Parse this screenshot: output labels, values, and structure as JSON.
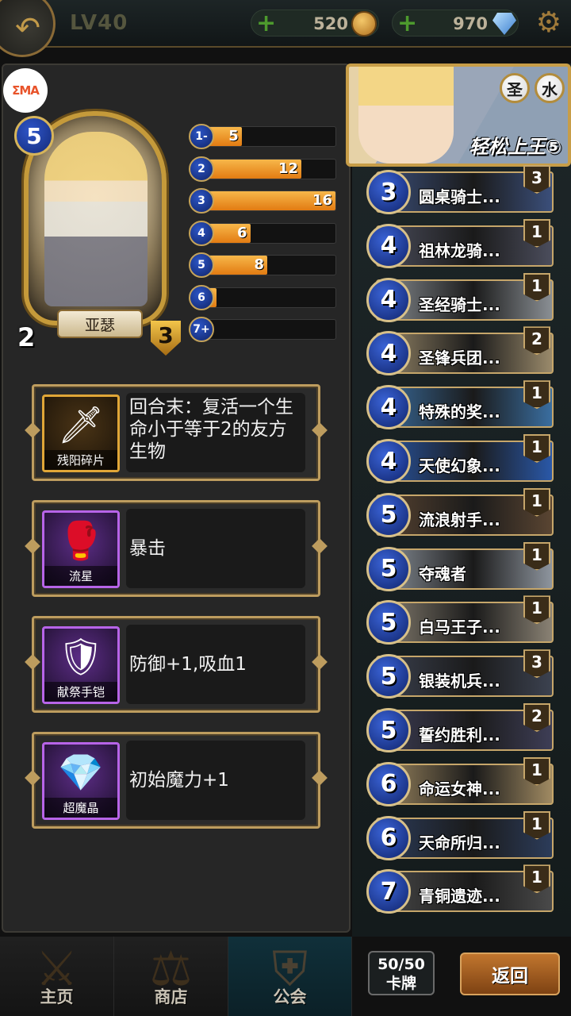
{
  "header": {
    "level": "LV40",
    "gold": "520",
    "gems": "970"
  },
  "hero": {
    "watermark": "ΣMA",
    "name": "亚瑟",
    "cost": "5",
    "attack": "2",
    "health": "3",
    "class_tags": [
      "圣",
      "水"
    ],
    "deck_title": "轻松上王⑤"
  },
  "mana_curve": [
    {
      "label": "1-",
      "count": "5",
      "value": 5
    },
    {
      "label": "2",
      "count": "12",
      "value": 12
    },
    {
      "label": "3",
      "count": "16",
      "value": 16
    },
    {
      "label": "4",
      "count": "6",
      "value": 6
    },
    {
      "label": "5",
      "count": "8",
      "value": 8
    },
    {
      "label": "6",
      "count": "2",
      "value": 2
    },
    {
      "label": "7+",
      "count": "1",
      "value": 1
    }
  ],
  "equipment": [
    {
      "name": "残阳碎片",
      "desc": "回合末：复活一个生命小于等于2的友方生物",
      "rarity": "gold",
      "icon": "dagger-icon"
    },
    {
      "name": "流星",
      "desc": "暴击",
      "rarity": "purple",
      "icon": "gauntlet-icon"
    },
    {
      "name": "献祭手铠",
      "desc": "防御+1,吸血1",
      "rarity": "purple",
      "icon": "armor-glove-icon"
    },
    {
      "name": "超魔晶",
      "desc": "初始魔力+1",
      "rarity": "purple",
      "icon": "crystal-icon"
    }
  ],
  "deck": [
    {
      "cost": "3",
      "name": "圆桌骑士...",
      "count": "3",
      "tint": "#3b4f7a"
    },
    {
      "cost": "4",
      "name": "祖林龙骑...",
      "count": "1",
      "tint": "#4b4d5c"
    },
    {
      "cost": "4",
      "name": "圣经骑士...",
      "count": "1",
      "tint": "#8a8f94"
    },
    {
      "cost": "4",
      "name": "圣锋兵团...",
      "count": "2",
      "tint": "#9a8a6b"
    },
    {
      "cost": "4",
      "name": "特殊的奖...",
      "count": "1",
      "tint": "#3a6ea0"
    },
    {
      "cost": "4",
      "name": "天使幻象...",
      "count": "1",
      "tint": "#2a58a8"
    },
    {
      "cost": "5",
      "name": "流浪射手...",
      "count": "1",
      "tint": "#5a4532"
    },
    {
      "cost": "5",
      "name": "夺魂者",
      "count": "1",
      "tint": "#8e959e"
    },
    {
      "cost": "5",
      "name": "白马王子...",
      "count": "1",
      "tint": "#8a8274"
    },
    {
      "cost": "5",
      "name": "银装机兵...",
      "count": "3",
      "tint": "#3c4250"
    },
    {
      "cost": "5",
      "name": "誓约胜利...",
      "count": "2",
      "tint": "#3e3e56"
    },
    {
      "cost": "6",
      "name": "命运女神...",
      "count": "1",
      "tint": "#a08a62"
    },
    {
      "cost": "6",
      "name": "天命所归...",
      "count": "1",
      "tint": "#2c3c5a"
    },
    {
      "cost": "7",
      "name": "青铜遗迹...",
      "count": "1",
      "tint": "#4a4a4a"
    }
  ],
  "footer": {
    "card_count": "50/50",
    "card_label": "卡牌",
    "return_label": "返回"
  },
  "nav": [
    {
      "label": "主页",
      "icon": "crossed-swords-icon"
    },
    {
      "label": "商店",
      "icon": "scales-icon"
    },
    {
      "label": "公会",
      "icon": "guild-shield-icon"
    }
  ],
  "colors": {
    "bar_fill": "#f0962a",
    "gold_frame": "#c59a3a",
    "mana_blue": "#2c55c6",
    "active_tab": "#10303a"
  }
}
